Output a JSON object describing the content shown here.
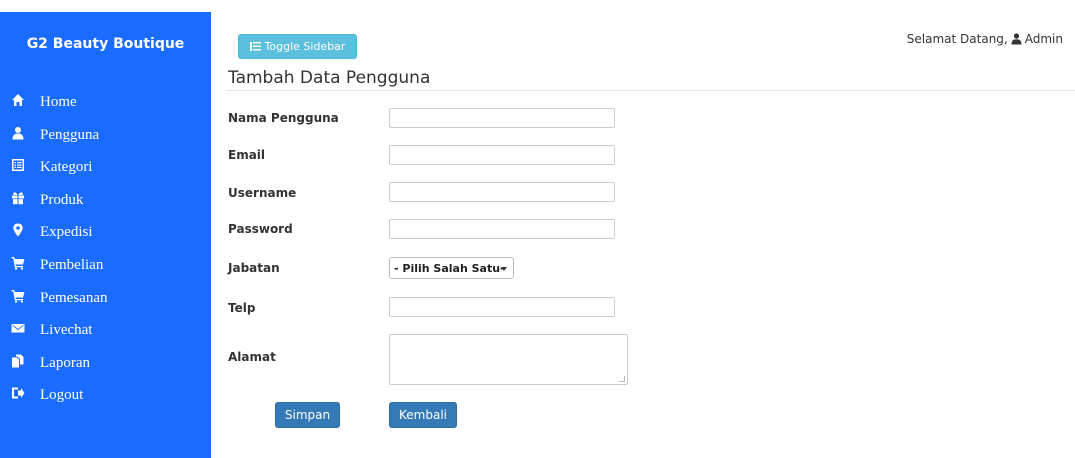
{
  "sidebar": {
    "brand": "G2 Beauty Boutique",
    "items": [
      {
        "label": "Home",
        "icon": "home-icon"
      },
      {
        "label": "Pengguna",
        "icon": "user-icon"
      },
      {
        "label": "Kategori",
        "icon": "list-icon"
      },
      {
        "label": "Produk",
        "icon": "gift-icon"
      },
      {
        "label": "Expedisi",
        "icon": "map-marker-icon"
      },
      {
        "label": "Pembelian",
        "icon": "shopping-cart-icon"
      },
      {
        "label": "Pemesanan",
        "icon": "shopping-cart-icon"
      },
      {
        "label": "Livechat",
        "icon": "envelope-icon"
      },
      {
        "label": "Laporan",
        "icon": "documents-icon"
      },
      {
        "label": "Logout",
        "icon": "log-out-icon"
      }
    ]
  },
  "header": {
    "toggle_label": "Toggle Sidebar",
    "welcome_text": "Selamat Datang,",
    "user_name": "Admin"
  },
  "form": {
    "title": "Tambah Data Pengguna",
    "fields": {
      "nama_pengguna": {
        "label": "Nama Pengguna",
        "value": ""
      },
      "email": {
        "label": "Email",
        "value": ""
      },
      "username": {
        "label": "Username",
        "value": ""
      },
      "password": {
        "label": "Password",
        "value": ""
      },
      "jabatan": {
        "label": "Jabatan",
        "selected": "- Pilih Salah Satu-"
      },
      "telp": {
        "label": "Telp",
        "value": ""
      },
      "alamat": {
        "label": "Alamat",
        "value": ""
      }
    },
    "save_label": "Simpan",
    "back_label": "Kembali"
  },
  "colors": {
    "sidebar_bg": "#1a6bff",
    "toggle_bg": "#5bc0de",
    "primary_button": "#337ab7"
  }
}
